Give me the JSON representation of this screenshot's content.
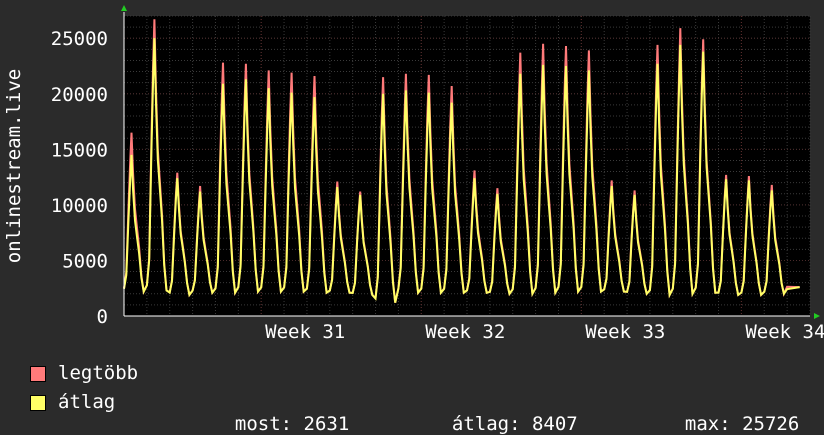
{
  "colors": {
    "background": "#2b2b2b",
    "plot": "#000000",
    "grid": "#3a3a3a",
    "max_series": "#ff7a7a",
    "avg_series": "#ffff66",
    "axis_arrow": "#22cc22"
  },
  "legend": [
    {
      "label": "legtöbb",
      "color": "#ff7a7a"
    },
    {
      "label": "átlag",
      "color": "#ffff66"
    }
  ],
  "stats": {
    "most_label": "most:",
    "most_value": "2631",
    "avg_label": "átlag:",
    "avg_value": "8407",
    "max_label": "max:",
    "max_value": "25726"
  },
  "chart_data": {
    "type": "line",
    "ylabel": "onlinestream.live",
    "ylim": [
      0,
      27000
    ],
    "yticks": [
      0,
      5000,
      10000,
      15000,
      20000,
      25000
    ],
    "ytick_labels": [
      "0",
      "5000",
      "10000",
      "15000",
      "20000",
      "25000"
    ],
    "xlim": [
      0,
      30
    ],
    "xticks": [
      {
        "x": 6.0,
        "label": "Week 31"
      },
      {
        "x": 13.0,
        "label": "Week 32"
      },
      {
        "x": 20.0,
        "label": "Week 33"
      },
      {
        "x": 27.0,
        "label": "Week 34"
      }
    ],
    "grid": true,
    "daily_peaks": {
      "x": [
        0,
        1,
        2,
        3,
        4,
        5,
        6,
        7,
        8,
        9,
        10,
        11,
        12,
        13,
        14,
        15,
        16,
        17,
        18,
        19,
        20,
        21,
        22,
        23,
        24,
        25,
        26,
        27,
        28,
        29
      ],
      "max": [
        16500,
        26700,
        12900,
        11700,
        22800,
        22700,
        22100,
        21900,
        21600,
        12100,
        11200,
        21500,
        21800,
        21700,
        20700,
        13100,
        11500,
        23700,
        24500,
        24300,
        23900,
        12200,
        11300,
        24400,
        25900,
        24900,
        12700,
        12600,
        11800,
        2631
      ],
      "avg": [
        14500,
        25000,
        12400,
        11200,
        20900,
        21300,
        20500,
        20100,
        19700,
        11600,
        10900,
        20000,
        20300,
        20100,
        19200,
        12400,
        11000,
        21800,
        22600,
        22500,
        22100,
        11700,
        10900,
        22700,
        24400,
        23800,
        12300,
        12200,
        11300,
        2400
      ],
      "trough": [
        2200,
        2300,
        1900,
        2100,
        2100,
        2200,
        2200,
        2200,
        2100,
        2100,
        1900,
        1200,
        2100,
        2100,
        2100,
        2100,
        2000,
        2000,
        2100,
        2200,
        2200,
        2200,
        2000,
        1900,
        2000,
        2100,
        1900,
        1900,
        2000,
        2600
      ]
    }
  }
}
